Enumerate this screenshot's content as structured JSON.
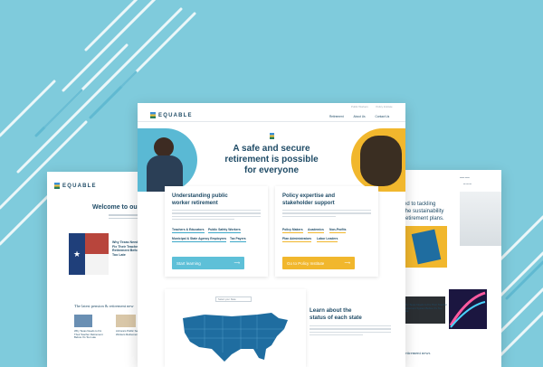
{
  "brand": {
    "name": "EQUABLE"
  },
  "main": {
    "top_links": [
      "Public Workers",
      "Policy Institute"
    ],
    "nav": [
      "Retirement",
      "About Us",
      "Contact Us"
    ],
    "hero_line1": "A safe and secure",
    "hero_line2": "retirement is possible",
    "hero_line3": "for everyone",
    "panel_left": {
      "title1": "Understanding public",
      "title2": "worker retirement",
      "tags": [
        "Teachers & Educators",
        "Public Safety Workers",
        "Municipal & State Agency Employees",
        "Tax Payers"
      ],
      "button": "Start learning",
      "arrow": "⟶"
    },
    "panel_right": {
      "title1": "Policy expertise and",
      "title2": "stakeholder support",
      "tags": [
        "Policy Makers",
        "Academics",
        "Non-Profits",
        "Plan Administrators",
        "Labor Leaders"
      ],
      "button": "Go to Policy Institute",
      "arrow": "⟶"
    },
    "map_select": "Select your State",
    "learn1": "Learn about the",
    "learn2": "status of each state"
  },
  "left_page": {
    "heading": "Welcome to ou",
    "news_title": "Why Texas Needs to Fix Their Teacher Retirement Before It's Too Late",
    "latest": "The latest pension & retirement new",
    "news_items": [
      "Why Texas Needs to Fix Their Teacher Retirement Before It's Too Late",
      "Arizona's Public Safety Workers Retirement"
    ]
  },
  "right_page": {
    "heading1": "ed to tackling",
    "heading2": "the sustainability",
    "heading3": "retirement plans.",
    "news_title": "Why Texas Needs to Fix Their Teacher Retirement System Before It's Too Late",
    "latest": "retirement news"
  },
  "colors": {
    "accent_blue": "#3ba8c8",
    "accent_yellow": "#f1b72d",
    "navy": "#1f4b66",
    "background": "#7fcbdc"
  }
}
